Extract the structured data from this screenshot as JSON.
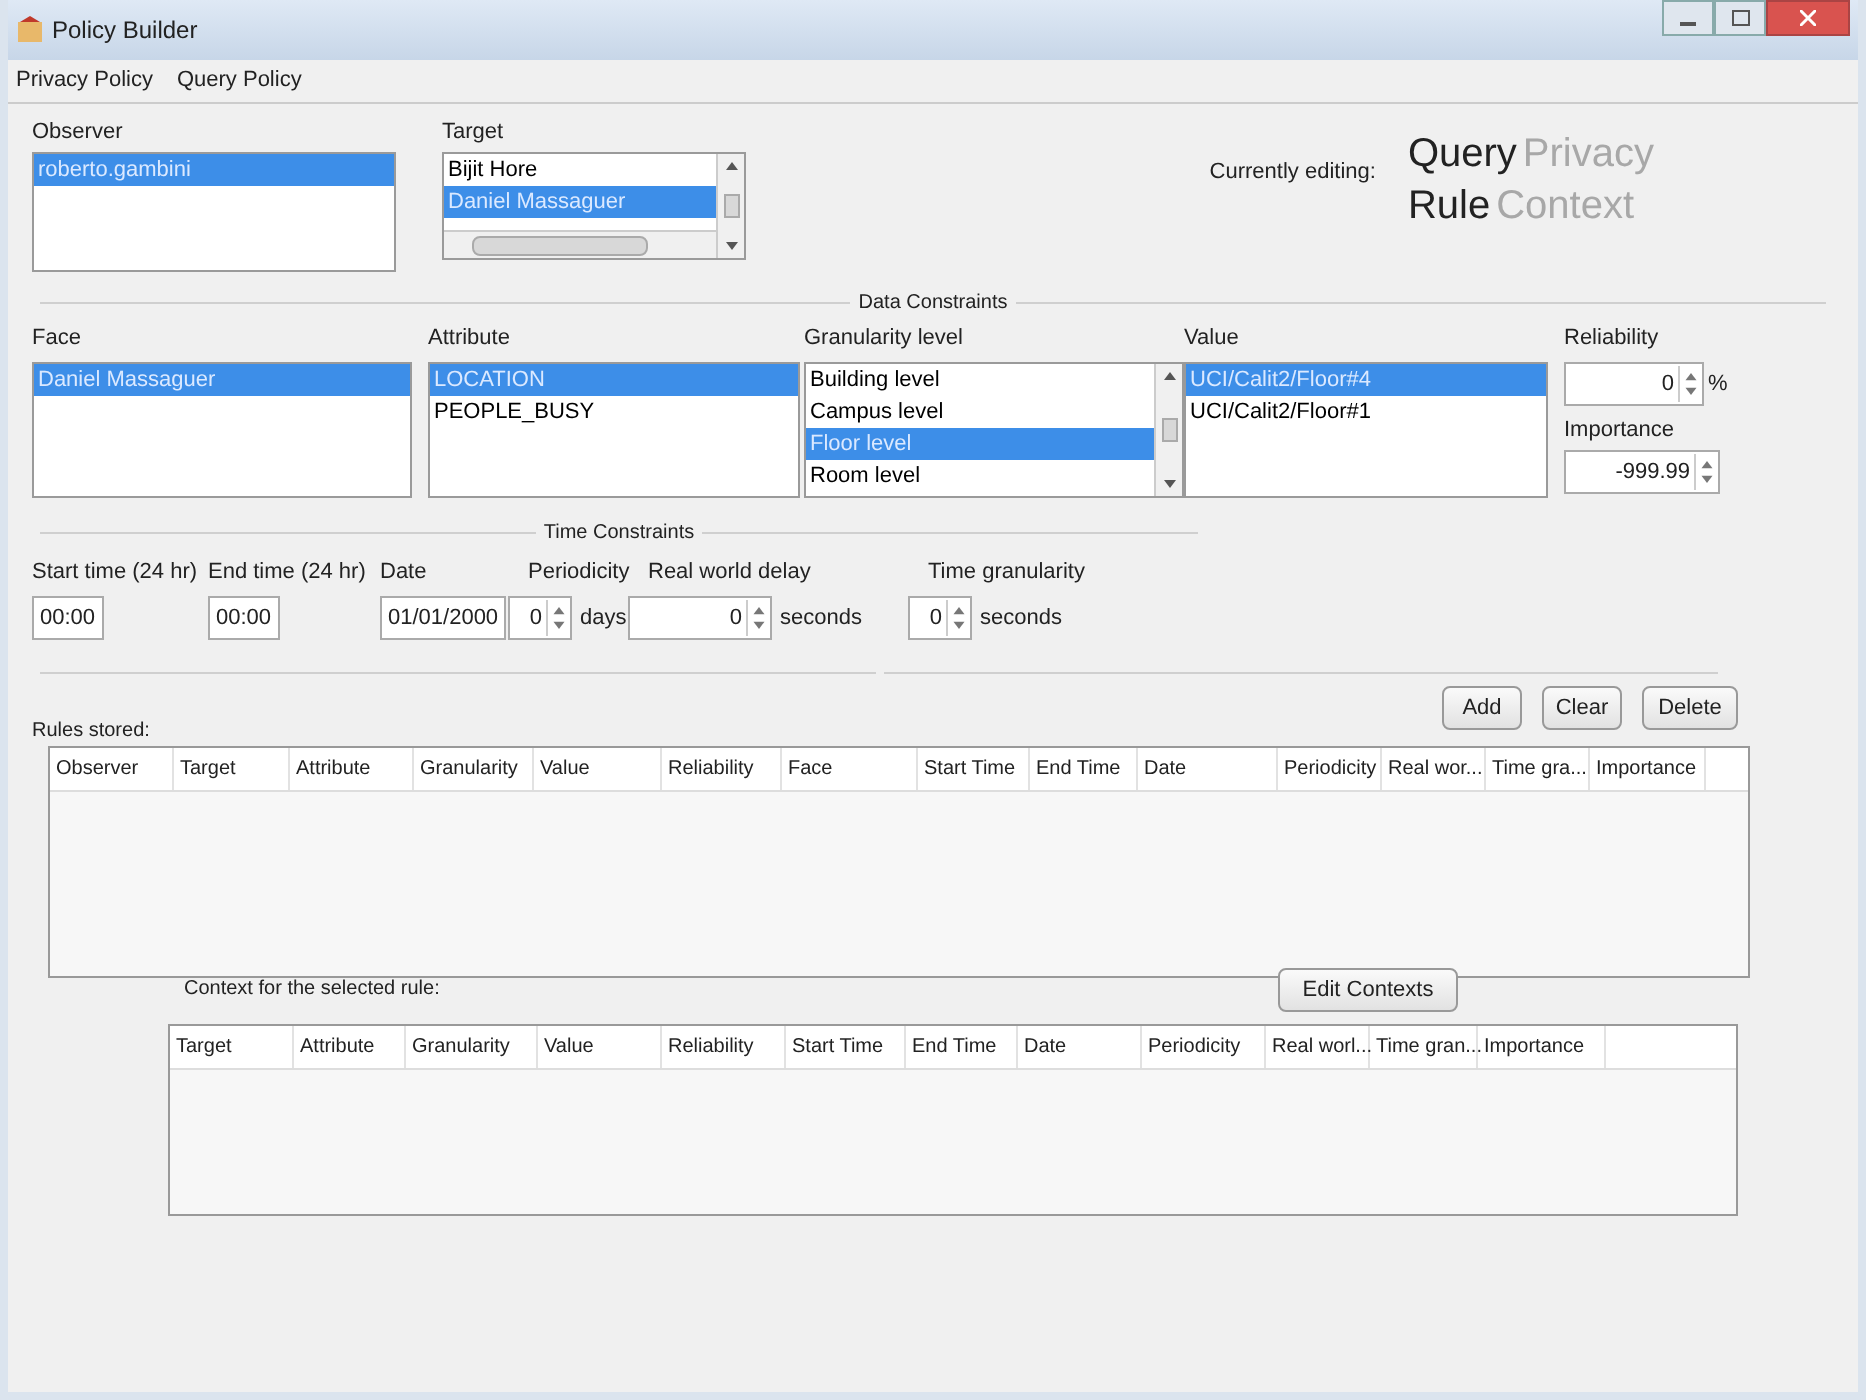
{
  "window": {
    "title": "Policy Builder"
  },
  "menu": [
    "Privacy Policy",
    "Query Policy"
  ],
  "observer": {
    "label": "Observer",
    "items": [
      {
        "text": "roberto.gambini",
        "selected": true
      }
    ]
  },
  "target": {
    "label": "Target",
    "items": [
      {
        "text": "Bijit Hore",
        "selected": false
      },
      {
        "text": "Daniel Massaguer",
        "selected": true
      }
    ]
  },
  "editing": {
    "label": "Currently editing:",
    "rows": [
      [
        {
          "text": "Query",
          "selected": true
        },
        {
          "text": "Privacy",
          "selected": false
        }
      ],
      [
        {
          "text": "Rule",
          "selected": true
        },
        {
          "text": "Context",
          "selected": false
        }
      ]
    ]
  },
  "data_constraints": {
    "title": "Data Constraints",
    "face": {
      "label": "Face",
      "items": [
        {
          "text": "Daniel Massaguer",
          "selected": true
        }
      ]
    },
    "attribute": {
      "label": "Attribute",
      "items": [
        {
          "text": "LOCATION",
          "selected": true
        },
        {
          "text": "PEOPLE_BUSY",
          "selected": false
        }
      ]
    },
    "granularity": {
      "label": "Granularity level",
      "items": [
        {
          "text": "Building level",
          "selected": false
        },
        {
          "text": "Campus level",
          "selected": false
        },
        {
          "text": "Floor level",
          "selected": true
        },
        {
          "text": "Room level",
          "selected": false
        }
      ]
    },
    "value": {
      "label": "Value",
      "items": [
        {
          "text": "UCI/Calit2/Floor#4",
          "selected": true
        },
        {
          "text": "UCI/Calit2/Floor#1",
          "selected": false
        }
      ]
    },
    "reliability": {
      "label": "Reliability",
      "value": "0",
      "unit": "%"
    },
    "importance": {
      "label": "Importance",
      "value": "-999.99"
    }
  },
  "time_constraints": {
    "title": "Time Constraints",
    "fields": [
      {
        "kind": "text",
        "label": "Start time (24 hr)",
        "value": "00:00"
      },
      {
        "kind": "text",
        "label": "End time (24 hr)",
        "value": "00:00"
      },
      {
        "kind": "text",
        "label": "Date",
        "value": "01/01/2000"
      },
      {
        "kind": "spinner",
        "label": "Periodicity",
        "value": "0",
        "unit": "days"
      },
      {
        "kind": "spinner",
        "label": "Real world delay",
        "value": "0",
        "unit": "seconds"
      },
      {
        "kind": "spinner",
        "label": "Time granularity",
        "value": "0",
        "unit": "seconds"
      }
    ]
  },
  "rules": {
    "label": "Rules stored:",
    "buttons": [
      "Add",
      "Clear",
      "Delete"
    ],
    "columns": [
      "Observer",
      "Target",
      "Attribute",
      "Granularity",
      "Value",
      "Reliability",
      "Face",
      "Start Time",
      "End Time",
      "Date",
      "Periodicity",
      "Real wor...",
      "Time gra...",
      "Importance"
    ]
  },
  "context": {
    "label": "Context for the selected rule:",
    "button": "Edit Contexts",
    "columns": [
      "Target",
      "Attribute",
      "Granularity",
      "Value",
      "Reliability",
      "Start Time",
      "End Time",
      "Date",
      "Periodicity",
      "Real worl...",
      "Time gran...",
      "Importance"
    ]
  }
}
